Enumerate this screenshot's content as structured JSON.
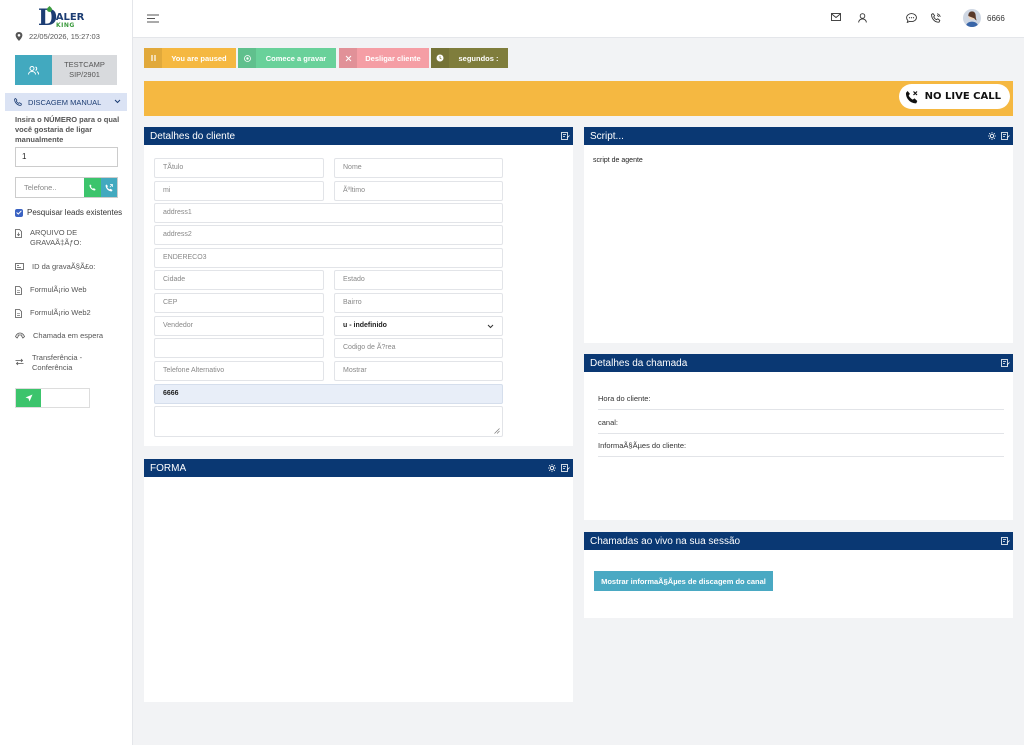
{
  "sidebar": {
    "logo": {
      "letter": "D",
      "line1": "IALER",
      "line2": "KING"
    },
    "datetime": "22/05/2026, 15:27:03",
    "campaign": "TESTCAMP",
    "sip": "SIP/2901",
    "manual_dial": "DISCAGEM MANUAL",
    "instruction": "Insira o NÚMERO para o qual você gostaria de ligar manualmente",
    "number_value": "1",
    "phone_placeholder": "Telefone..",
    "search_leads": "Pesquisar leads existentes",
    "items": [
      {
        "label": "ARQUIVO DE GRAVAÃ‡ÃƒO:"
      },
      {
        "label": "ID da gravaÃ§Ã£o:"
      },
      {
        "label": "FormulÃ¡rio Web"
      },
      {
        "label": "FormulÃ¡rio Web2"
      },
      {
        "label": "Chamada em espera"
      },
      {
        "label": "Transferência - Conferência"
      }
    ]
  },
  "topbar": {
    "user_ext": "6666"
  },
  "actions": {
    "paused": "You are paused",
    "record": "Comece a gravar",
    "hangup": "Desligar cliente",
    "seconds": "segundos :"
  },
  "banner": {
    "no_live_call": "NO LIVE CALL"
  },
  "customer": {
    "title": "Detalhes do cliente",
    "fields": {
      "titulo": "TÃtulo",
      "nome": "Nome",
      "mi": "mi",
      "ultimo": "Ãºltimo",
      "address1": "address1",
      "address2": "address2",
      "endereco3": "ENDERECO3",
      "cidade": "Cidade",
      "estado": "Estado",
      "cep": "CEP",
      "bairro": "Bairro",
      "vendedor": "Vendedor",
      "gender_select": "u - indefinido",
      "codigo_area": "Codigo de Ã?rea",
      "telefone_alt": "Telefone Alternativo",
      "mostrar": "Mostrar",
      "phone_value": "6666"
    }
  },
  "forma": {
    "title": "FORMA"
  },
  "script": {
    "title": "Script...",
    "text": "script de agente"
  },
  "call_details": {
    "title": "Detalhes da chamada",
    "rows": [
      "Hora do cliente:",
      "canal:",
      "InformaÃ§Ãµes do cliente:"
    ]
  },
  "live_calls": {
    "title": "Chamadas ao vivo na sua sessão",
    "button": "Mostrar informaÃ§Ãµes de discagem do canal"
  },
  "colors": {
    "navy": "#0a3873",
    "banner": "#f5b841",
    "paused": "#f5b841",
    "record": "#69d19a",
    "hangup": "#f59ea5",
    "seconds": "#7f7d3c",
    "teal": "#42a9bf",
    "green": "#3cc46c"
  }
}
